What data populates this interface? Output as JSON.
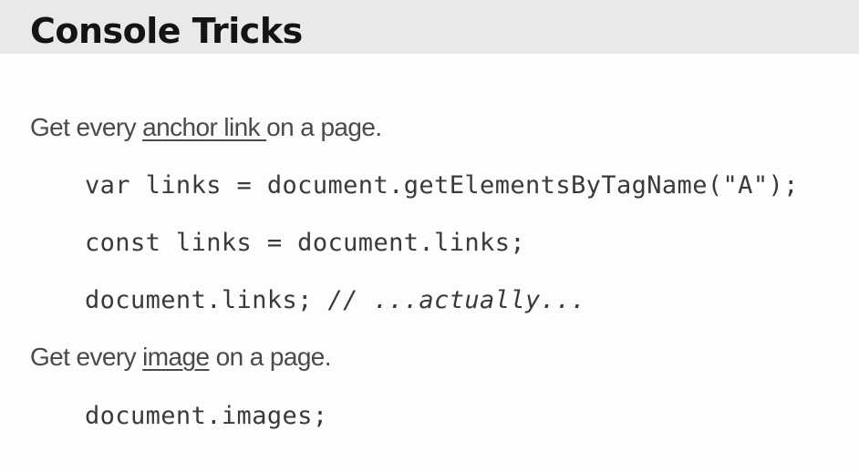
{
  "slide": {
    "title": "Console Tricks"
  },
  "section_links": {
    "prefix": "Get every ",
    "link": "anchor link ",
    "suffix": "on a page.",
    "code": [
      "var links = document.getElementsByTagName(\"A\");",
      "const links = document.links;"
    ],
    "code_last_main": "document.links;  ",
    "code_last_comment": "// ...actually..."
  },
  "section_images": {
    "prefix": "Get every ",
    "link": "image",
    "suffix": " on a page.",
    "code": [
      "document.images;"
    ]
  }
}
